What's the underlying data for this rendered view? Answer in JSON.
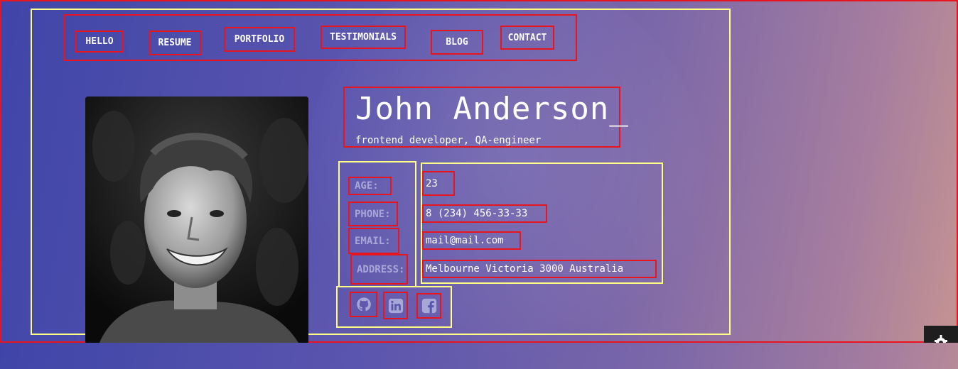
{
  "nav": {
    "items": [
      {
        "label": "HELLO"
      },
      {
        "label": "RESUME"
      },
      {
        "label": "PORTFOLIO"
      },
      {
        "label": "TESTIMONIALS"
      },
      {
        "label": "BLOG"
      },
      {
        "label": "CONTACT"
      }
    ]
  },
  "profile": {
    "name": "John Anderson_",
    "subtitle": "frontend developer, QA-engineer",
    "fields": [
      {
        "label": "AGE:",
        "value": "23"
      },
      {
        "label": "PHONE:",
        "value": "8 (234) 456-33-33"
      },
      {
        "label": "EMAIL:",
        "value": "mail@mail.com"
      },
      {
        "label": "ADDRESS:",
        "value": "Melbourne Victoria 3000 Australia"
      }
    ]
  },
  "social": {
    "icons": [
      "github-icon",
      "linkedin-icon",
      "facebook-icon"
    ]
  },
  "colors": {
    "label": "#a7a7d8",
    "annotation_red": "#e8141e",
    "annotation_yellow": "#ffff88"
  }
}
